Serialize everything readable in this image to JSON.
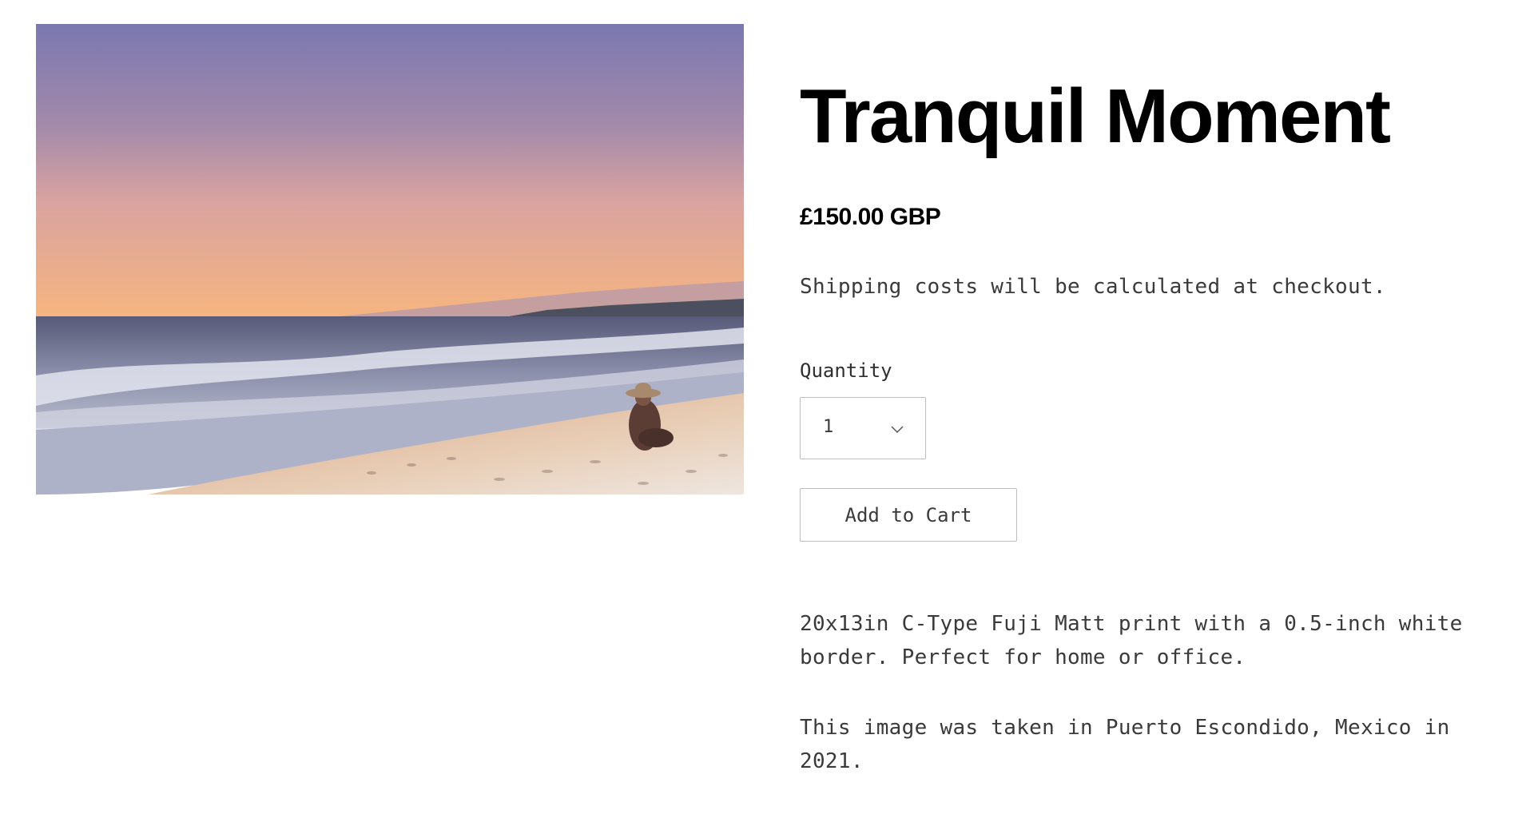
{
  "product": {
    "title": "Tranquil Moment",
    "price": "£150.00 GBP",
    "shipping_note": "Shipping costs will be calculated at checkout.",
    "image": {
      "subject": "sunset beach with seated person in sun hat",
      "colors": {
        "sky_top": "#7a78b0",
        "sky_mid": "#c89ca6",
        "sky_low": "#f4b884",
        "sea": "#6c7494",
        "foam": "#dfe0ea",
        "sand": "#e7c7a4"
      }
    },
    "quantity": {
      "label": "Quantity",
      "selected": "1",
      "icon": "chevron-down-icon"
    },
    "add_to_cart_label": "Add to Cart",
    "description": [
      "20x13in C-Type Fuji Matt print with a 0.5-inch white border. Perfect for home or office.",
      "This image was taken in Puerto Escondido, Mexico in 2021."
    ]
  }
}
